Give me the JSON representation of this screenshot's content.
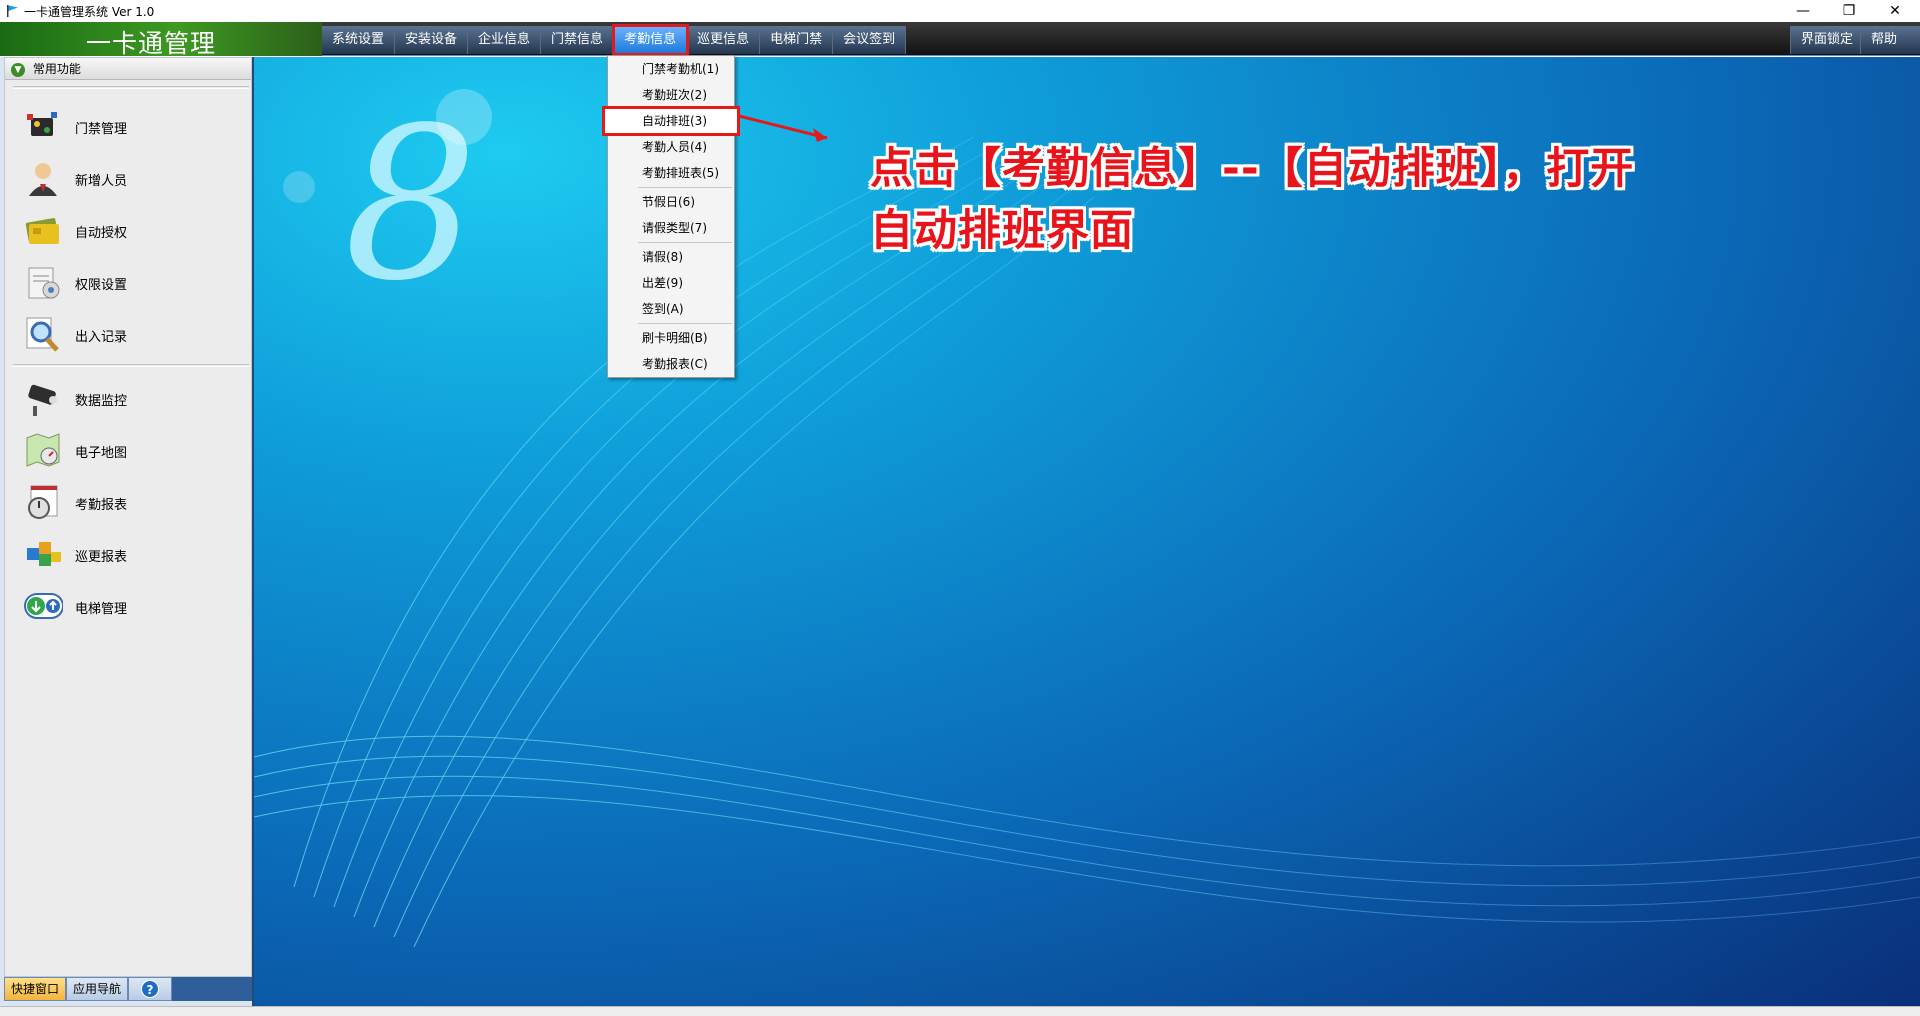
{
  "window": {
    "title": "一卡通管理系统  Ver 1.0",
    "minimize": "—",
    "restore": "❐",
    "close": "✕"
  },
  "brand": {
    "text": "一卡通管理"
  },
  "menu": {
    "items": [
      "系统设置",
      "安装设备",
      "企业信息",
      "门禁信息",
      "考勤信息",
      "巡更信息",
      "电梯门禁",
      "会议签到"
    ],
    "active": "考勤信息",
    "right": [
      "界面锁定",
      "帮助"
    ]
  },
  "sidebar": {
    "header": "常用功能",
    "items": [
      "门禁管理",
      "新增人员",
      "自动授权",
      "权限设置",
      "出入记录",
      "数据监控",
      "电子地图",
      "考勤报表",
      "巡更报表",
      "电梯管理"
    ],
    "icons": [
      "chip-icon",
      "person-icon",
      "card-icon",
      "document-icon",
      "magnifier-icon",
      "camera-icon",
      "map-icon",
      "clock-icon",
      "puzzle-icon",
      "elevator-icon"
    ],
    "tabs": [
      "快捷窗口",
      "应用导航"
    ],
    "help": "?"
  },
  "dropdown": {
    "items": [
      "门禁考勤机(1)",
      "考勤班次(2)",
      "自动排班(3)",
      "考勤人员(4)",
      "考勤排班表(5)",
      "节假日(6)",
      "请假类型(7)",
      "请假(8)",
      "出差(9)",
      "签到(A)",
      "刷卡明细(B)",
      "考勤报表(C)"
    ],
    "highlighted": "自动排班(3)"
  },
  "annotation": {
    "line1": "点击【考勤信息】--【自动排班】，打开",
    "line2": "自动排班界面"
  },
  "colors": {
    "accent_red": "#e41a1a",
    "menu_active": "#1c78d8",
    "brand_green": "#3e9a22",
    "background_blue": "#0b6ab8"
  }
}
